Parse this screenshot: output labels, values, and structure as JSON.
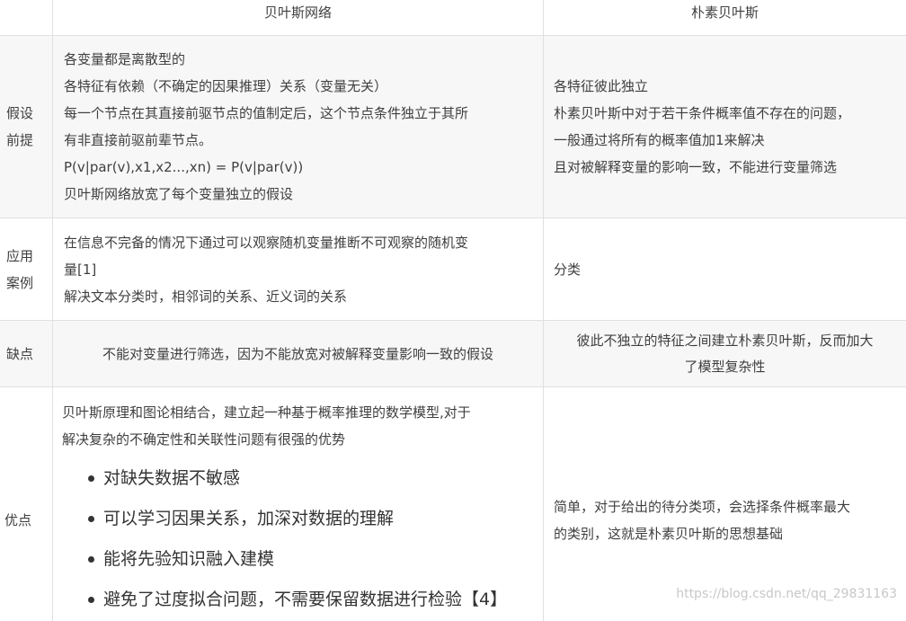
{
  "header": {
    "col0": "",
    "col1": "贝叶斯网络",
    "col2": "朴素贝叶斯"
  },
  "rows": [
    {
      "label_lines": [
        "假设",
        "前提"
      ],
      "bayes_net_lines": [
        "各变量都是离散型的",
        "各特征有依赖（不确定的因果推理）关系（变量无关）",
        "每一个节点在其直接前驱节点的值制定后，这个节点条件独立于其所",
        "有非直接前驱前辈节点。",
        "P(v|par(v),x1,x2...,xn) = P(v|par(v))",
        "贝叶斯网络放宽了每个变量独立的假设"
      ],
      "naive_bayes_lines": [
        "各特征彼此独立",
        "朴素贝叶斯中对于若干条件概率值不存在的问题，",
        "一般通过将所有的概率值加1来解决",
        "且对被解释变量的影响一致，不能进行变量筛选"
      ]
    },
    {
      "label_lines": [
        "应用",
        "案例"
      ],
      "bayes_net_lines": [
        "在信息不完备的情况下通过可以观察随机变量推断不可观察的随机变",
        "量[1]",
        "解决文本分类时，相邻词的关系、近义词的关系"
      ],
      "naive_bayes_lines": [
        "分类"
      ]
    },
    {
      "label_lines": [
        "缺点"
      ],
      "bayes_net_lines": [
        "不能对变量进行筛选，因为不能放宽对被解释变量影响一致的假设"
      ],
      "naive_bayes_lines": [
        "彼此不独立的特征之间建立朴素贝叶斯，反而加大",
        "了模型复杂性"
      ]
    },
    {
      "label_lines": [
        "优点"
      ],
      "bayes_net_lines": [
        "贝叶斯原理和图论相结合，建立起一种基于概率推理的数学模型,对于",
        "解决复杂的不确定性和关联性问题有很强的优势"
      ],
      "bayes_net_bullets": [
        "对缺失数据不敏感",
        "可以学习因果关系，加深对数据的理解",
        "能将先验知识融入建模",
        "避免了过度拟合问题，不需要保留数据进行检验【4】"
      ],
      "naive_bayes_lines": [
        "简单，对于给出的待分类项，会选择条件概率最大",
        "的类别，这就是朴素贝叶斯的思想基础"
      ]
    }
  ],
  "watermark": "https://blog.csdn.net/qq_29831163"
}
